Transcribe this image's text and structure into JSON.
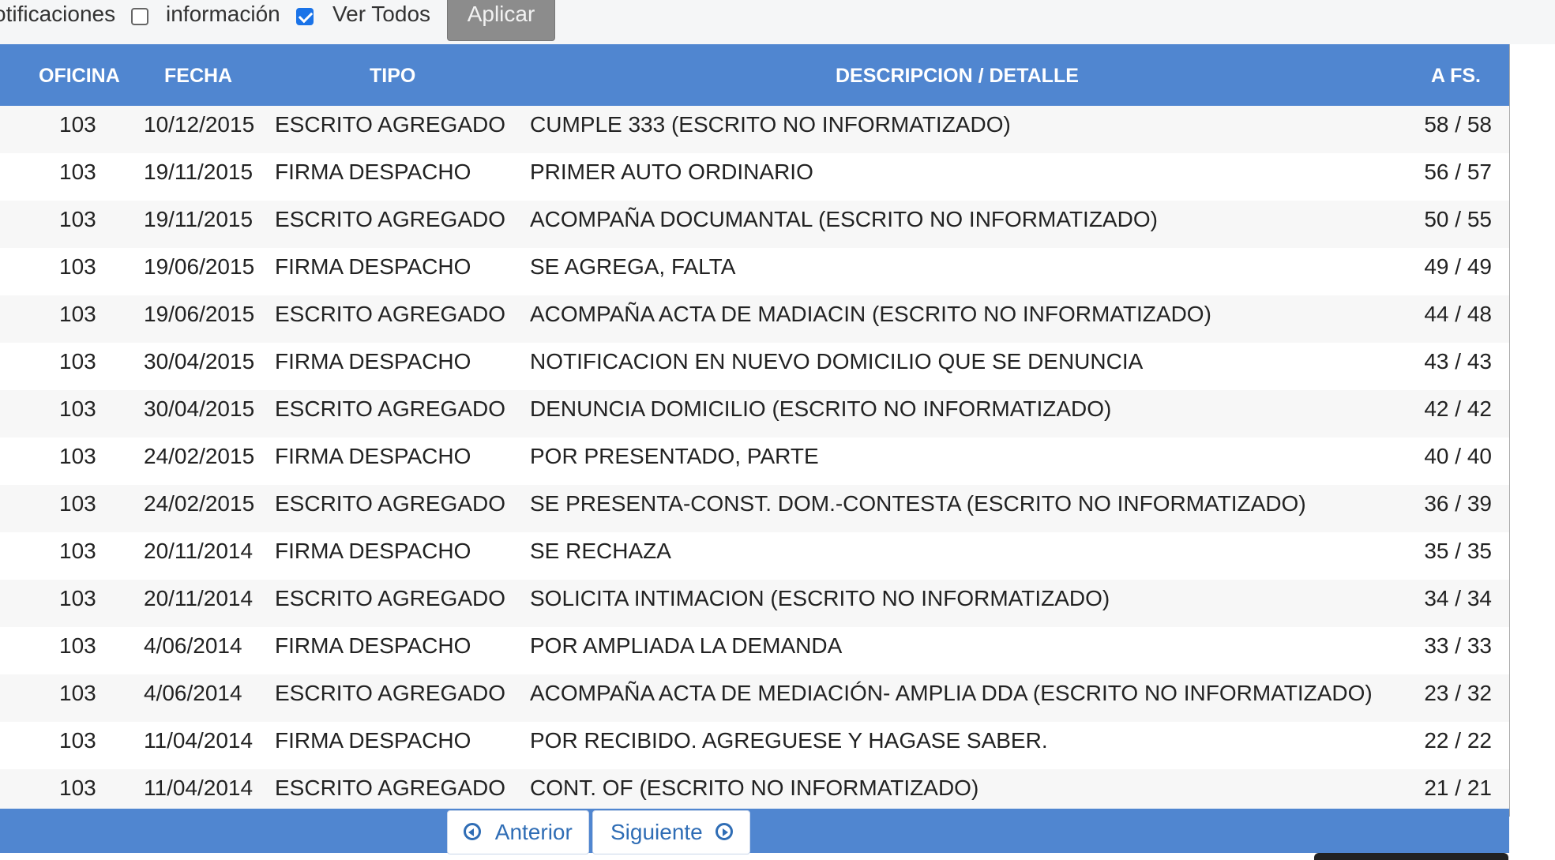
{
  "filters": {
    "label_notifications": "otificaciones",
    "label_info": "información",
    "info_checked": false,
    "label_all": "Ver Todos",
    "all_checked": true,
    "apply_label": "Aplicar"
  },
  "table": {
    "columns": [
      "OFICINA",
      "FECHA",
      "TIPO",
      "DESCRIPCION / DETALLE",
      "A FS."
    ],
    "rows": [
      {
        "oficina": "103",
        "fecha": "10/12/2015",
        "tipo": "ESCRITO AGREGADO",
        "descripcion": "CUMPLE 333 (ESCRITO NO INFORMATIZADO)",
        "fs": "58 / 58"
      },
      {
        "oficina": "103",
        "fecha": "19/11/2015",
        "tipo": "FIRMA DESPACHO",
        "descripcion": "PRIMER AUTO ORDINARIO",
        "fs": "56 / 57"
      },
      {
        "oficina": "103",
        "fecha": "19/11/2015",
        "tipo": "ESCRITO AGREGADO",
        "descripcion": "ACOMPAÑA DOCUMANTAL (ESCRITO NO INFORMATIZADO)",
        "fs": "50 / 55"
      },
      {
        "oficina": "103",
        "fecha": "19/06/2015",
        "tipo": "FIRMA DESPACHO",
        "descripcion": "SE AGREGA, FALTA",
        "fs": "49 / 49"
      },
      {
        "oficina": "103",
        "fecha": "19/06/2015",
        "tipo": "ESCRITO AGREGADO",
        "descripcion": "ACOMPAÑA ACTA DE MADIACIN (ESCRITO NO INFORMATIZADO)",
        "fs": "44 / 48"
      },
      {
        "oficina": "103",
        "fecha": "30/04/2015",
        "tipo": "FIRMA DESPACHO",
        "descripcion": "NOTIFICACION EN NUEVO DOMICILIO QUE SE DENUNCIA",
        "fs": "43 / 43"
      },
      {
        "oficina": "103",
        "fecha": "30/04/2015",
        "tipo": "ESCRITO AGREGADO",
        "descripcion": "DENUNCIA DOMICILIO (ESCRITO NO INFORMATIZADO)",
        "fs": "42 / 42"
      },
      {
        "oficina": "103",
        "fecha": "24/02/2015",
        "tipo": "FIRMA DESPACHO",
        "descripcion": "POR PRESENTADO, PARTE",
        "fs": "40 / 40"
      },
      {
        "oficina": "103",
        "fecha": "24/02/2015",
        "tipo": "ESCRITO AGREGADO",
        "descripcion": "SE PRESENTA-CONST. DOM.-CONTESTA (ESCRITO NO INFORMATIZADO)",
        "fs": "36 / 39"
      },
      {
        "oficina": "103",
        "fecha": "20/11/2014",
        "tipo": "FIRMA DESPACHO",
        "descripcion": "SE RECHAZA",
        "fs": "35 / 35"
      },
      {
        "oficina": "103",
        "fecha": "20/11/2014",
        "tipo": "ESCRITO AGREGADO",
        "descripcion": "SOLICITA INTIMACION (ESCRITO NO INFORMATIZADO)",
        "fs": "34 / 34"
      },
      {
        "oficina": "103",
        "fecha": "4/06/2014",
        "tipo": "FIRMA DESPACHO",
        "descripcion": "POR AMPLIADA LA DEMANDA",
        "fs": "33 / 33"
      },
      {
        "oficina": "103",
        "fecha": "4/06/2014",
        "tipo": "ESCRITO AGREGADO",
        "descripcion": "ACOMPAÑA ACTA DE MEDIACIÓN- AMPLIA DDA (ESCRITO NO INFORMATIZADO)",
        "fs": "23 / 32"
      },
      {
        "oficina": "103",
        "fecha": "11/04/2014",
        "tipo": "FIRMA DESPACHO",
        "descripcion": "POR RECIBIDO. AGREGUESE Y HAGASE SABER.",
        "fs": "22 / 22"
      },
      {
        "oficina": "103",
        "fecha": "11/04/2014",
        "tipo": "ESCRITO AGREGADO",
        "descripcion": "CONT. OF (ESCRITO NO INFORMATIZADO)",
        "fs": "21 / 21"
      }
    ]
  },
  "pagination": {
    "prev_label": "Anterior",
    "next_label": "Siguiente",
    "prev_icon": "arrow-circle-left-icon",
    "next_icon": "arrow-circle-right-icon"
  },
  "colors": {
    "header_blue": "#5086d0",
    "link_blue": "#2f6db5",
    "apply_gray": "#8c8c8c"
  }
}
